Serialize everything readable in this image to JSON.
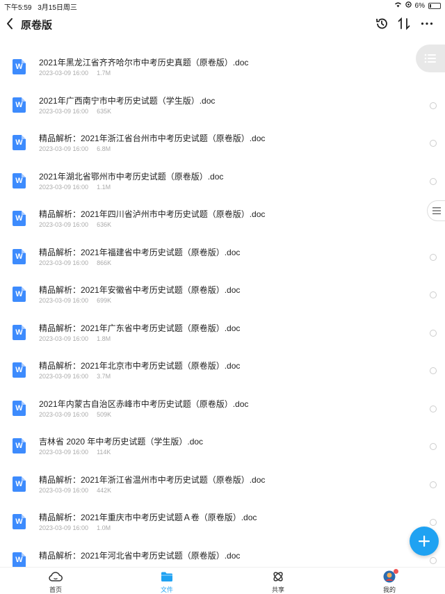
{
  "status": {
    "time": "下午5:59",
    "date": "3月15日周三",
    "battery": "6%"
  },
  "header": {
    "title": "原卷版"
  },
  "files": [
    {
      "name": "2021年黑龙江省齐齐哈尔市中考历史真题（原卷版）.doc",
      "date": "2023-03-09 16:00",
      "size": "1.7M"
    },
    {
      "name": "2021年广西南宁市中考历史试题（学生版）.doc",
      "date": "2023-03-09 16:00",
      "size": "635K"
    },
    {
      "name": "精品解析：2021年浙江省台州市中考历史试题（原卷版）.doc",
      "date": "2023-03-09 16:00",
      "size": "6.8M"
    },
    {
      "name": "2021年湖北省鄂州市中考历史试题（原卷版）.doc",
      "date": "2023-03-09 16:00",
      "size": "1.1M"
    },
    {
      "name": "精品解析：2021年四川省泸州市中考历史试题（原卷版）.doc",
      "date": "2023-03-09 16:00",
      "size": "636K"
    },
    {
      "name": "精品解析：2021年福建省中考历史试题（原卷版）.doc",
      "date": "2023-03-09 16:00",
      "size": "866K"
    },
    {
      "name": "精品解析：2021年安徽省中考历史试题（原卷版）.doc",
      "date": "2023-03-09 16:00",
      "size": "699K"
    },
    {
      "name": "精品解析：2021年广东省中考历史试题（原卷版）.doc",
      "date": "2023-03-09 16:00",
      "size": "1.8M"
    },
    {
      "name": "精品解析：2021年北京市中考历史试题（原卷版）.doc",
      "date": "2023-03-09 16:00",
      "size": "3.7M"
    },
    {
      "name": "2021年内蒙古自治区赤峰市中考历史试题（原卷版）.doc",
      "date": "2023-03-09 16:00",
      "size": "509K"
    },
    {
      "name": "吉林省 2020 年中考历史试题（学生版）.doc",
      "date": "2023-03-09 16:00",
      "size": "114K"
    },
    {
      "name": "精品解析：2021年浙江省温州市中考历史试题（原卷版）.doc",
      "date": "2023-03-09 16:00",
      "size": "442K"
    },
    {
      "name": "精品解析：2021年重庆市中考历史试题Ａ卷（原卷版）.doc",
      "date": "2023-03-09 16:00",
      "size": "1.0M"
    },
    {
      "name": "精品解析：2021年河北省中考历史试题（原卷版）.doc",
      "date": "",
      "size": ""
    }
  ],
  "file_icon_letter": "W",
  "nav": {
    "home": "首页",
    "files": "文件",
    "share": "共享",
    "mine": "我的"
  },
  "colors": {
    "accent": "#1fa2f2",
    "file_icon": "#3d8bfd"
  }
}
